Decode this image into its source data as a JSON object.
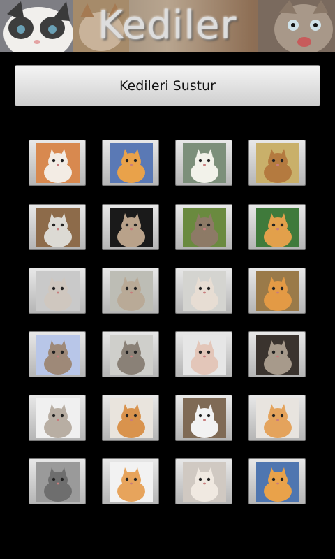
{
  "header": {
    "title": "Kediler"
  },
  "actions": {
    "silence_label": "Kedileri Sustur"
  },
  "cats": [
    {
      "id": "cat-1",
      "bg": "#d8894f",
      "fur": "#f3ece4"
    },
    {
      "id": "cat-2",
      "bg": "#5a79b5",
      "fur": "#e9a24a"
    },
    {
      "id": "cat-3",
      "bg": "#7c8f7a",
      "fur": "#f2f2ea"
    },
    {
      "id": "cat-4",
      "bg": "#c9b06a",
      "fur": "#b47a3f"
    },
    {
      "id": "cat-5",
      "bg": "#8d6b4a",
      "fur": "#dcdad4"
    },
    {
      "id": "cat-6",
      "bg": "#1a1a1a",
      "fur": "#b9a28a"
    },
    {
      "id": "cat-7",
      "bg": "#6a8a3f",
      "fur": "#8d7a66"
    },
    {
      "id": "cat-8",
      "bg": "#3f7a3b",
      "fur": "#e2a04b"
    },
    {
      "id": "cat-9",
      "bg": "#c9c9c9",
      "fur": "#cfc7bf"
    },
    {
      "id": "cat-10",
      "bg": "#bdbdb5",
      "fur": "#b9aa97"
    },
    {
      "id": "cat-11",
      "bg": "#d4d4d0",
      "fur": "#e7ddd3"
    },
    {
      "id": "cat-12",
      "bg": "#9a7a49",
      "fur": "#e39a45"
    },
    {
      "id": "cat-13",
      "bg": "#b8c6e8",
      "fur": "#9e8978"
    },
    {
      "id": "cat-14",
      "bg": "#cfcfcb",
      "fur": "#8a8177"
    },
    {
      "id": "cat-15",
      "bg": "#e6e6e6",
      "fur": "#e3c6b9"
    },
    {
      "id": "cat-16",
      "bg": "#3a332e",
      "fur": "#a79a8b"
    },
    {
      "id": "cat-17",
      "bg": "#f0f0f0",
      "fur": "#b8aea3"
    },
    {
      "id": "cat-18",
      "bg": "#e9e4dd",
      "fur": "#d9934d"
    },
    {
      "id": "cat-19",
      "bg": "#7f6a55",
      "fur": "#f2f2f2"
    },
    {
      "id": "cat-20",
      "bg": "#e8e4df",
      "fur": "#e4a35c"
    },
    {
      "id": "cat-21",
      "bg": "#9a9a9a",
      "fur": "#6e6e6e"
    },
    {
      "id": "cat-22",
      "bg": "#f2f2f2",
      "fur": "#e7a45c"
    },
    {
      "id": "cat-23",
      "bg": "#d0c9c2",
      "fur": "#f0e9e1"
    },
    {
      "id": "cat-24",
      "bg": "#4f76b0",
      "fur": "#e9a24a"
    }
  ]
}
